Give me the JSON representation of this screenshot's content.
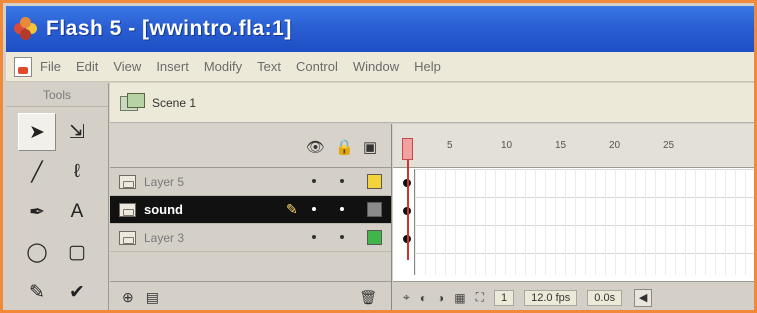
{
  "window": {
    "title": "Flash 5 - [wwintro.fla:1]",
    "icon": "flash-flower-icon",
    "colors": {
      "titlebar": "#2a5fd3",
      "frame": "#f08a3a"
    }
  },
  "menubar": {
    "items": [
      "File",
      "Edit",
      "View",
      "Insert",
      "Modify",
      "Text",
      "Control",
      "Window",
      "Help"
    ]
  },
  "tools": {
    "header": "Tools",
    "items": [
      {
        "name": "arrow-tool-icon",
        "glyph": "➤"
      },
      {
        "name": "subselect-tool-icon",
        "glyph": "⇲"
      },
      {
        "name": "line-tool-icon",
        "glyph": "╱"
      },
      {
        "name": "lasso-tool-icon",
        "glyph": "ℓ"
      },
      {
        "name": "pen-tool-icon",
        "glyph": "✒"
      },
      {
        "name": "text-tool-icon",
        "glyph": "A"
      },
      {
        "name": "oval-tool-icon",
        "glyph": "◯"
      },
      {
        "name": "rectangle-tool-icon",
        "glyph": "▢"
      },
      {
        "name": "pencil-tool-icon",
        "glyph": "✎"
      },
      {
        "name": "brush-tool-icon",
        "glyph": "✔"
      }
    ]
  },
  "scene": {
    "label": "Scene 1"
  },
  "timeline": {
    "ruler_ticks": [
      "5",
      "10",
      "15",
      "20",
      "25"
    ],
    "layers": [
      {
        "name": "Layer 5",
        "swatch": "#f3d23a",
        "active": false
      },
      {
        "name": "sound",
        "swatch": "#8a8a8a",
        "active": true
      },
      {
        "name": "Layer 3",
        "swatch": "#3fb54a",
        "active": false
      }
    ],
    "footer": {
      "current_frame": "1",
      "frame_rate": "12.0 fps",
      "elapsed": "0.0s"
    }
  }
}
